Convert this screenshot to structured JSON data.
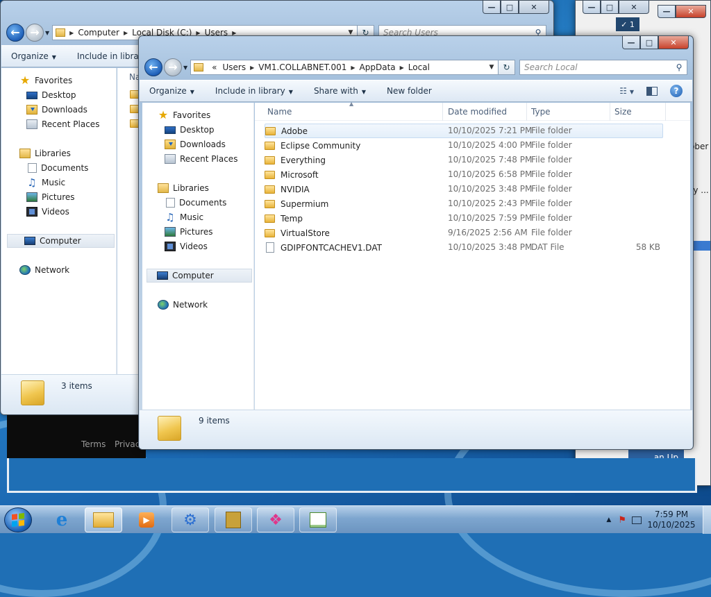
{
  "background_window_a": {
    "title_fragment": "...",
    "badge": "1"
  },
  "background_window_b": {
    "address": [
      "Computer",
      "Local Disk (C:)",
      "Users"
    ],
    "search_placeholder": "Search Users",
    "toolbar": {
      "organize": "Organize",
      "include": "Include in library"
    },
    "col_name_fragment": "Na",
    "nav": {
      "favorites": "Favorites",
      "desktop": "Desktop",
      "downloads": "Downloads",
      "recent": "Recent Places",
      "libraries": "Libraries",
      "documents": "Documents",
      "music": "Music",
      "pictures": "Pictures",
      "videos": "Videos",
      "computer": "Computer",
      "network": "Network"
    },
    "status": "3 items",
    "footer_links": {
      "terms": "Terms",
      "privacy": "Privac"
    },
    "right_fragments": {
      "a": "ober",
      "b": "ly ...",
      "c": "an Up"
    }
  },
  "main_window": {
    "address": [
      "«",
      "Users",
      "VM1.COLLABNET.001",
      "AppData",
      "Local"
    ],
    "search_placeholder": "Search Local",
    "toolbar": {
      "organize": "Organize",
      "include": "Include in library",
      "share": "Share with",
      "new_folder": "New folder"
    },
    "nav": {
      "favorites": "Favorites",
      "desktop": "Desktop",
      "downloads": "Downloads",
      "recent": "Recent Places",
      "libraries": "Libraries",
      "documents": "Documents",
      "music": "Music",
      "pictures": "Pictures",
      "videos": "Videos",
      "computer": "Computer",
      "network": "Network"
    },
    "columns": {
      "name": "Name",
      "date": "Date modified",
      "type": "Type",
      "size": "Size"
    },
    "files": [
      {
        "name": "Adobe",
        "date": "10/10/2025 7:21 PM",
        "type": "File folder",
        "size": "",
        "kind": "folder",
        "selected": true
      },
      {
        "name": "Eclipse Community",
        "date": "10/10/2025 4:00 PM",
        "type": "File folder",
        "size": "",
        "kind": "folder"
      },
      {
        "name": "Everything",
        "date": "10/10/2025 7:48 PM",
        "type": "File folder",
        "size": "",
        "kind": "folder"
      },
      {
        "name": "Microsoft",
        "date": "10/10/2025 6:58 PM",
        "type": "File folder",
        "size": "",
        "kind": "folder"
      },
      {
        "name": "NVIDIA",
        "date": "10/10/2025 3:48 PM",
        "type": "File folder",
        "size": "",
        "kind": "folder"
      },
      {
        "name": "Supermium",
        "date": "10/10/2025 2:43 PM",
        "type": "File folder",
        "size": "",
        "kind": "folder"
      },
      {
        "name": "Temp",
        "date": "10/10/2025 7:59 PM",
        "type": "File folder",
        "size": "",
        "kind": "folder"
      },
      {
        "name": "VirtualStore",
        "date": "9/16/2025 2:56 AM",
        "type": "File folder",
        "size": "",
        "kind": "folder"
      },
      {
        "name": "GDIPFONTCACHEV1.DAT",
        "date": "10/10/2025 3:48 PM",
        "type": "DAT File",
        "size": "58 KB",
        "kind": "file"
      }
    ],
    "status": "9 items"
  },
  "taskbar": {
    "icons": [
      "start-orb",
      "internet-explorer",
      "windows-explorer",
      "media-player",
      "control-panel",
      "editor",
      "browser-fox",
      "task-list"
    ],
    "clock_time": "7:59 PM",
    "clock_date": "10/10/2025"
  },
  "colors": {
    "accent": "#1f6fb5",
    "selection": "#e4effa",
    "folder": "#e8b43a"
  }
}
